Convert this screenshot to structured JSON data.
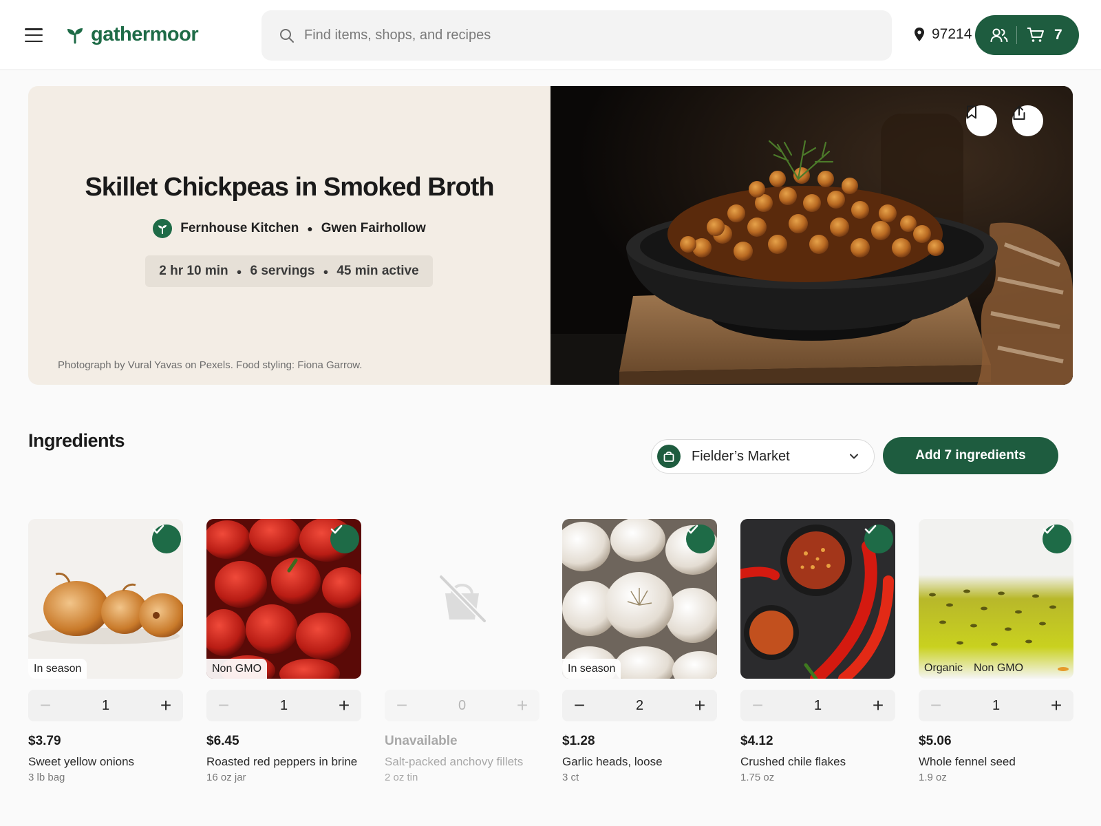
{
  "brand": {
    "name": "gathermoor"
  },
  "search": {
    "placeholder": "Find items, shops, and recipes"
  },
  "location": {
    "zip": "97214"
  },
  "cart": {
    "count": "7"
  },
  "recipe": {
    "title": "Skillet Chickpeas in Smoked Broth",
    "publisher": "Fernhouse Kitchen",
    "author": "Gwen Fairhollow",
    "total_time": "2 hr 10 min",
    "servings": "6 servings",
    "active_time": "45 min active",
    "credit": "Photograph by Vural Yavas on Pexels. Food styling: Fiona Garrow."
  },
  "ingredients": {
    "heading": "Ingredients",
    "store": "Fielder’s Market",
    "add_label": "Add 7 ingredients",
    "items": [
      {
        "badges": [
          "In season"
        ],
        "qty": "1",
        "price": "$3.79",
        "name": "Sweet yellow onions",
        "size": "3 lb bag",
        "selected": true
      },
      {
        "badges": [
          "Non GMO"
        ],
        "qty": "1",
        "price": "$6.45",
        "name": "Roasted red peppers in brine",
        "size": "16 oz jar",
        "selected": true
      },
      {
        "badges": [],
        "qty": "0",
        "price": "Unavailable",
        "name": "Salt-packed anchovy fillets",
        "size": "2 oz tin",
        "selected": false
      },
      {
        "badges": [
          "In season"
        ],
        "qty": "2",
        "price": "$1.28",
        "name": "Garlic heads, loose",
        "size": "3 ct",
        "selected": true
      },
      {
        "badges": [],
        "qty": "1",
        "price": "$4.12",
        "name": "Crushed chile flakes",
        "size": "1.75 oz",
        "selected": true
      },
      {
        "badges": [
          "Organic",
          "Non GMO"
        ],
        "qty": "1",
        "price": "$5.06",
        "name": "Whole fennel seed",
        "size": "1.9 oz",
        "selected": true
      }
    ]
  },
  "colors": {
    "brand_green": "#1e5c3f",
    "check_green": "#1e6b47",
    "hero_bg": "#f3ede5"
  }
}
